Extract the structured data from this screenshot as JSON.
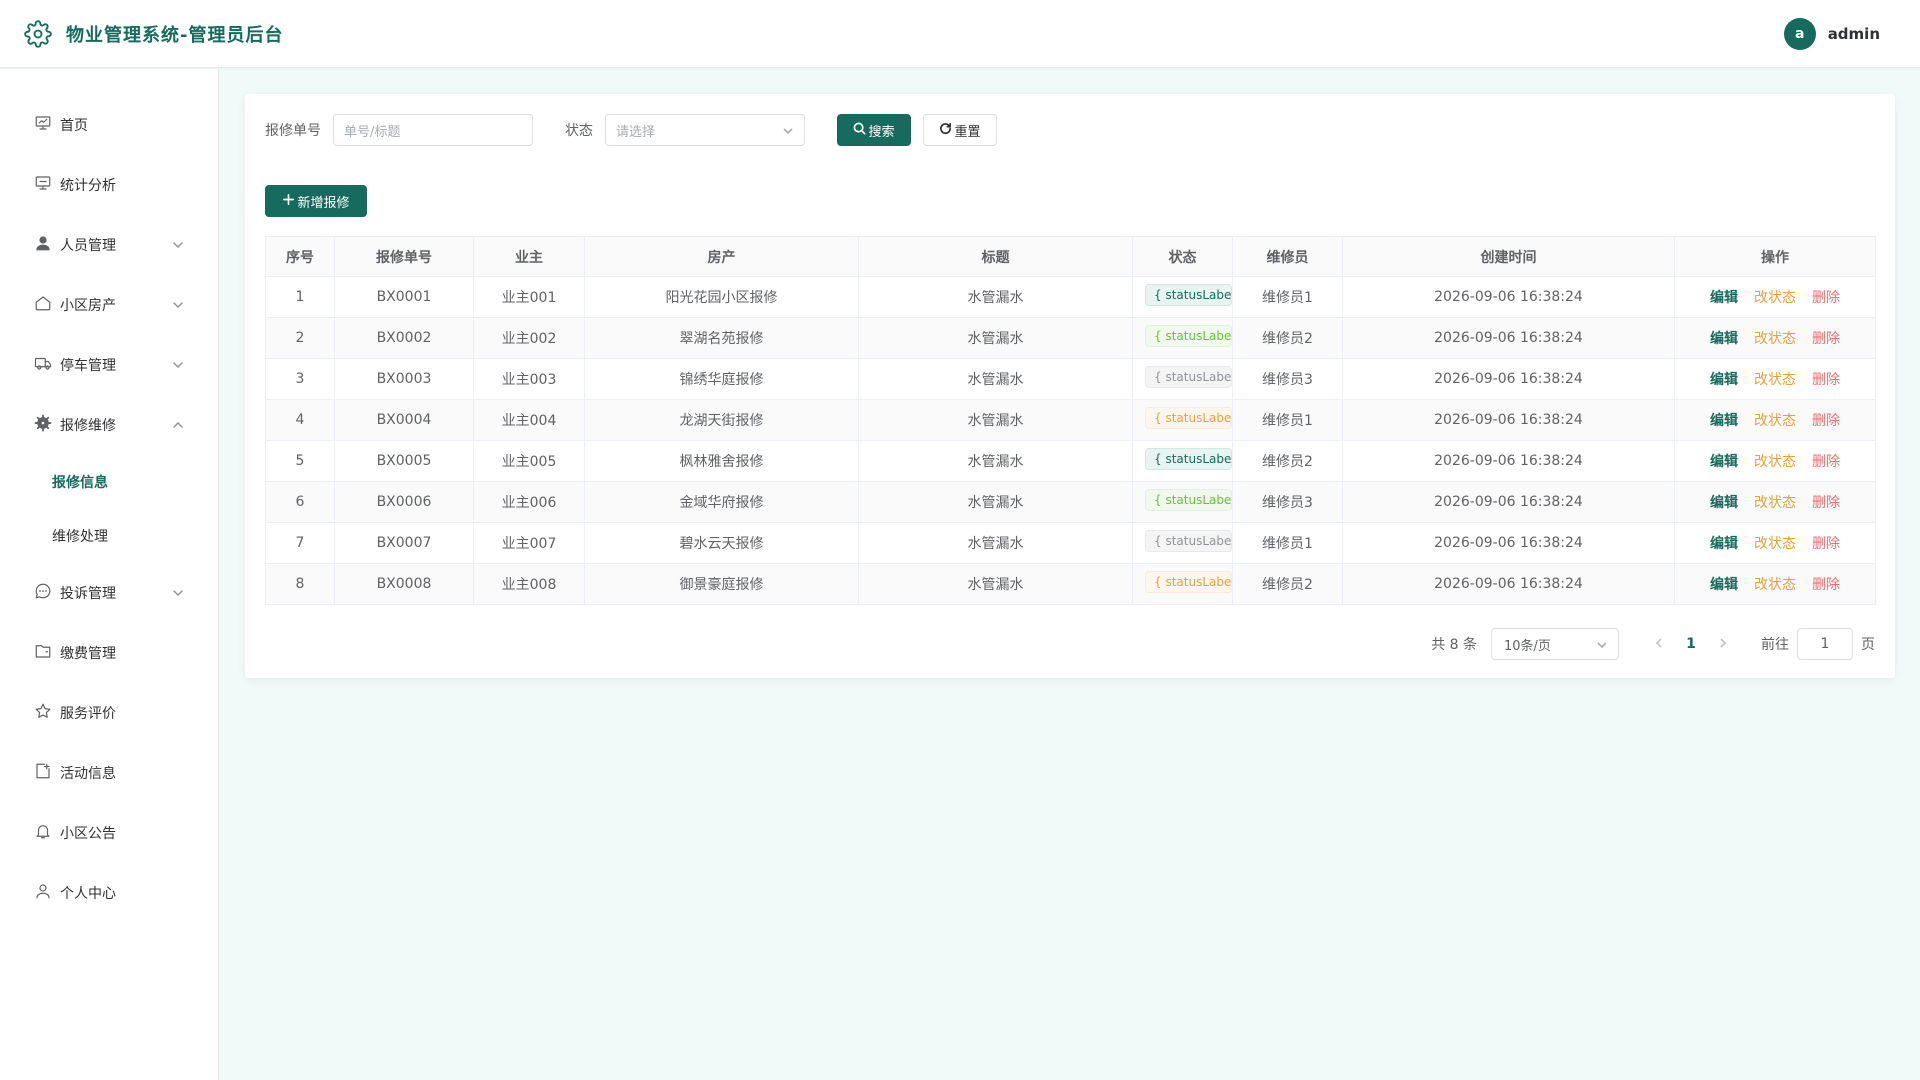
{
  "header": {
    "title": "物业管理系统-管理员后台",
    "avatar_letter": "a",
    "username": "admin"
  },
  "sidebar": {
    "items": [
      {
        "label": "首页",
        "icon": "monitor-icon"
      },
      {
        "label": "统计分析",
        "icon": "chart-icon"
      },
      {
        "label": "人员管理",
        "icon": "user-icon",
        "expandable": true
      },
      {
        "label": "小区房产",
        "icon": "house-icon",
        "expandable": true
      },
      {
        "label": "停车管理",
        "icon": "car-icon",
        "expandable": true
      },
      {
        "label": "报修维修",
        "icon": "gear-icon",
        "expanded": true,
        "children": [
          {
            "label": "报修信息",
            "active": true
          },
          {
            "label": "维修处理"
          }
        ]
      },
      {
        "label": "投诉管理",
        "icon": "chat-icon",
        "expandable": true
      },
      {
        "label": "缴费管理",
        "icon": "wallet-icon"
      },
      {
        "label": "服务评价",
        "icon": "star-icon"
      },
      {
        "label": "活动信息",
        "icon": "notice-icon"
      },
      {
        "label": "小区公告",
        "icon": "bell-icon"
      },
      {
        "label": "个人中心",
        "icon": "person-icon"
      }
    ]
  },
  "search": {
    "order_label": "报修单号",
    "order_placeholder": "单号/标题",
    "status_label": "状态",
    "status_placeholder": "请选择",
    "search_button": "搜索",
    "reset_button": "重置"
  },
  "add_button": "新增报修",
  "table": {
    "columns": [
      "序号",
      "报修单号",
      "业主",
      "房产",
      "标题",
      "状态",
      "维修员",
      "创建时间",
      "操作"
    ],
    "rows": [
      {
        "no": "1",
        "order": "BX0001",
        "owner": "业主001",
        "property": "阳光花园小区报修",
        "title": "水管漏水",
        "status": "{ statusLabel(r",
        "status_type": "primary",
        "worker": "维修员1",
        "created": "2026-09-06 16:38:24"
      },
      {
        "no": "2",
        "order": "BX0002",
        "owner": "业主002",
        "property": "翠湖名苑报修",
        "title": "水管漏水",
        "status": "{ statusLabel(r",
        "status_type": "success",
        "worker": "维修员2",
        "created": "2026-09-06 16:38:24"
      },
      {
        "no": "3",
        "order": "BX0003",
        "owner": "业主003",
        "property": "锦绣华庭报修",
        "title": "水管漏水",
        "status": "{ statusLabel(r",
        "status_type": "info",
        "worker": "维修员3",
        "created": "2026-09-06 16:38:24"
      },
      {
        "no": "4",
        "order": "BX0004",
        "owner": "业主004",
        "property": "龙湖天街报修",
        "title": "水管漏水",
        "status": "{ statusLabel(r",
        "status_type": "warning",
        "worker": "维修员1",
        "created": "2026-09-06 16:38:24"
      },
      {
        "no": "5",
        "order": "BX0005",
        "owner": "业主005",
        "property": "枫林雅舍报修",
        "title": "水管漏水",
        "status": "{ statusLabel(r",
        "status_type": "primary",
        "worker": "维修员2",
        "created": "2026-09-06 16:38:24"
      },
      {
        "no": "6",
        "order": "BX0006",
        "owner": "业主006",
        "property": "金域华府报修",
        "title": "水管漏水",
        "status": "{ statusLabel(r",
        "status_type": "success",
        "worker": "维修员3",
        "created": "2026-09-06 16:38:24"
      },
      {
        "no": "7",
        "order": "BX0007",
        "owner": "业主007",
        "property": "碧水云天报修",
        "title": "水管漏水",
        "status": "{ statusLabel(r",
        "status_type": "info",
        "worker": "维修员1",
        "created": "2026-09-06 16:38:24"
      },
      {
        "no": "8",
        "order": "BX0008",
        "owner": "业主008",
        "property": "御景豪庭报修",
        "title": "水管漏水",
        "status": "{ statusLabel(r",
        "status_type": "warning",
        "worker": "维修员2",
        "created": "2026-09-06 16:38:24"
      }
    ],
    "actions": {
      "edit": "编辑",
      "status": "改状态",
      "delete": "删除"
    }
  },
  "pagination": {
    "total_text": "共 8 条",
    "page_size": "10条/页",
    "current_page": "1",
    "goto_label": "前往",
    "goto_value": "1",
    "page_unit": "页"
  },
  "colors": {
    "primary": "#176b5e",
    "warning": "#e6a23c",
    "danger": "#f56c6c",
    "success": "#67c23a",
    "background": "#f0faf8"
  }
}
